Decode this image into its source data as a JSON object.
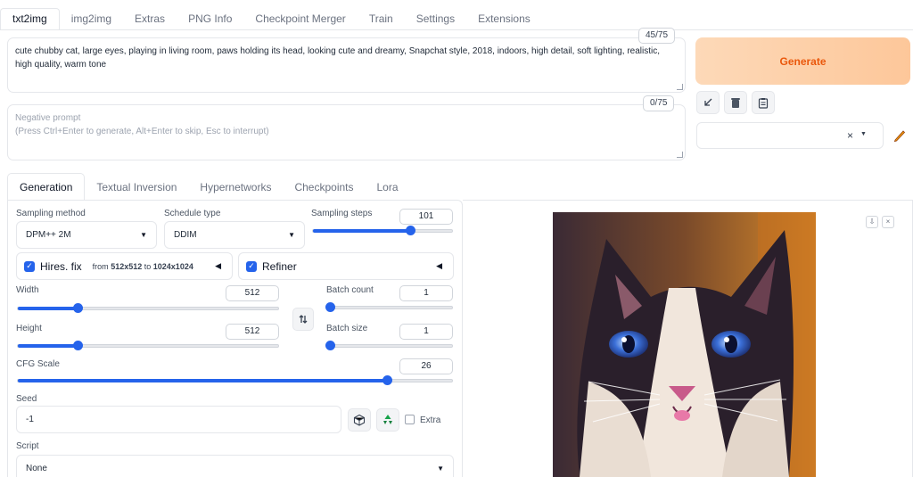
{
  "tabs": [
    "txt2img",
    "img2img",
    "Extras",
    "PNG Info",
    "Checkpoint Merger",
    "Train",
    "Settings",
    "Extensions"
  ],
  "prompt": {
    "value": "cute chubby cat, large eyes, playing in living room, paws holding its head, looking cute and dreamy, Snapchat style, 2018, indoors, high detail, soft lighting, realistic, high quality, warm tone",
    "counter": "45/75"
  },
  "negative_prompt": {
    "placeholder_line1": "Negative prompt",
    "placeholder_line2": "(Press Ctrl+Enter to generate, Alt+Enter to skip, Esc to interrupt)",
    "counter": "0/75"
  },
  "generate_label": "Generate",
  "styles_clear": "×",
  "subtabs": [
    "Generation",
    "Textual Inversion",
    "Hypernetworks",
    "Checkpoints",
    "Lora"
  ],
  "sampling_method": {
    "label": "Sampling method",
    "value": "DPM++ 2M"
  },
  "schedule_type": {
    "label": "Schedule type",
    "value": "DDIM"
  },
  "sampling_steps": {
    "label": "Sampling steps",
    "value": "101",
    "fraction": 0.7
  },
  "hires": {
    "label": "Hires. fix",
    "from_prefix": "from",
    "from_value": "512x512",
    "to_prefix": "to",
    "to_value": "1024x1024"
  },
  "refiner": {
    "label": "Refiner"
  },
  "width": {
    "label": "Width",
    "value": "512",
    "fraction": 0.23
  },
  "height": {
    "label": "Height",
    "value": "512",
    "fraction": 0.23
  },
  "batch_count": {
    "label": "Batch count",
    "value": "1",
    "fraction": 0.0
  },
  "batch_size": {
    "label": "Batch size",
    "value": "1",
    "fraction": 0.0
  },
  "cfg_scale": {
    "label": "CFG Scale",
    "value": "26",
    "fraction": 0.85
  },
  "seed": {
    "label": "Seed",
    "value": "-1",
    "extra_label": "Extra"
  },
  "script": {
    "label": "Script",
    "value": "None"
  },
  "colors": {
    "accent": "#2563eb",
    "generate_text": "#ea580c"
  }
}
